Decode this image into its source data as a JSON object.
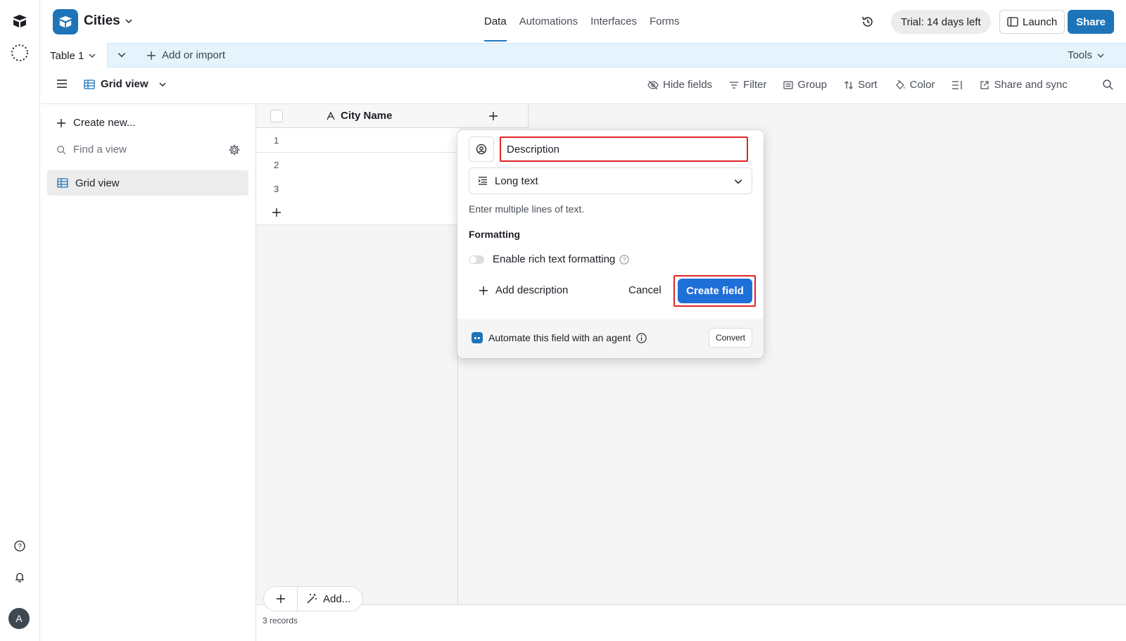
{
  "rail": {
    "icons": [
      "home-icon",
      "workspace-icon",
      "help-icon",
      "bell-icon"
    ],
    "avatar_letter": "A"
  },
  "header": {
    "base_name": "Cities",
    "nav": [
      "Data",
      "Automations",
      "Interfaces",
      "Forms"
    ],
    "active_nav": "Data",
    "trial": "Trial: 14 days left",
    "launch_label": "Launch",
    "share_label": "Share"
  },
  "tabbar": {
    "table_tab": "Table 1",
    "add_import": "Add or import",
    "tools": "Tools"
  },
  "viewbar": {
    "view_name": "Grid view",
    "tools": {
      "hide_fields": "Hide fields",
      "filter": "Filter",
      "group": "Group",
      "sort": "Sort",
      "color": "Color",
      "share_sync": "Share and sync"
    }
  },
  "sidebar": {
    "create_new": "Create new...",
    "find_placeholder": "Find a view",
    "views": [
      "Grid view"
    ]
  },
  "grid": {
    "primary_field": "City Name",
    "row_numbers": [
      "1",
      "2",
      "3"
    ],
    "add_label": "Add...",
    "record_count": "3 records"
  },
  "popup": {
    "field_name": "Description",
    "field_type": "Long text",
    "type_description": "Enter multiple lines of text.",
    "formatting_title": "Formatting",
    "rich_text_label": "Enable rich text formatting",
    "rich_text_enabled": false,
    "add_description": "Add description",
    "cancel_label": "Cancel",
    "create_label": "Create field",
    "agent_label": "Automate this field with an agent",
    "convert_label": "Convert"
  },
  "colors": {
    "brand_blue": "#1e74b8",
    "create_blue": "#1f6fd9",
    "highlight_red": "#e02424",
    "tabbar_bg": "#e4f3fc"
  }
}
